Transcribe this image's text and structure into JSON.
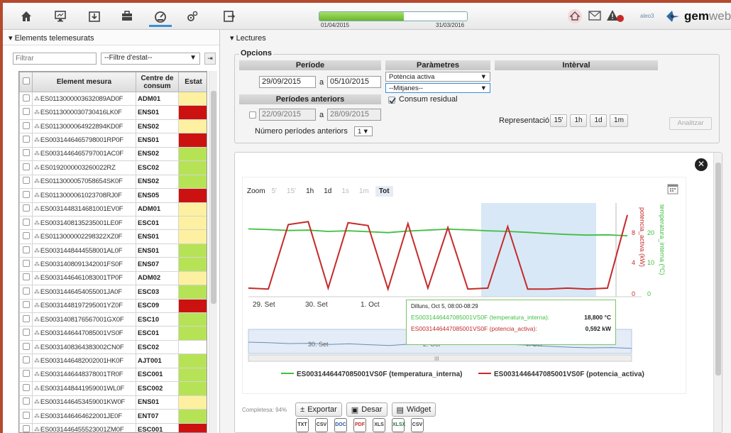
{
  "toolbar": {
    "icons": [
      "home-icon",
      "monitor-icon",
      "download-box-icon",
      "briefcase-icon",
      "gauge-icon",
      "gears-icon",
      "export-icon"
    ],
    "progress": 0.57,
    "progress_start": "01/04/2015",
    "progress_end": "31/03/2016",
    "user": "aleo3",
    "brand_main": "gem",
    "brand_suffix": "web"
  },
  "left": {
    "title": "Elements telemesurats",
    "filter_placeholder": "Filtrar",
    "state_filter": "--Filtre d'estat--",
    "columns": [
      "Element mesura",
      "Centre de consum",
      "Estat"
    ],
    "rows": [
      {
        "name": "ES0113000003632089AD0F",
        "code": "ADM01",
        "state": "#fdf0a0"
      },
      {
        "name": "ES0113000030730416LK0F",
        "code": "ENS01",
        "state": "#cc1111"
      },
      {
        "name": "ES0113000064922894KD0F",
        "code": "ENS02",
        "state": "#fdf0a0"
      },
      {
        "name": "ES0031446465798001RP0F",
        "code": "ENS01",
        "state": "#cc1111"
      },
      {
        "name": "ES0031446465797001AC0F",
        "code": "ENS02",
        "state": "#b6e355"
      },
      {
        "name": "ES0192000003260022RZ",
        "code": "ESC02",
        "state": "#b6e355"
      },
      {
        "name": "ES0113000057058654SK0F",
        "code": "ENS02",
        "state": "#b6e355"
      },
      {
        "name": "ES0113000061023708RJ0F",
        "code": "ENS05",
        "state": "#cc1111"
      },
      {
        "name": "ES0031448314681001EV0F",
        "code": "ADM01",
        "state": "#fdf0a0"
      },
      {
        "name": "ES0031408135235001LE0F",
        "code": "ESC01",
        "state": "#fdf0a0"
      },
      {
        "name": "ES0113000002298322XZ0F",
        "code": "ENS01",
        "state": "#fdf0a0"
      },
      {
        "name": "ES0031448444558001AL0F",
        "code": "ENS01",
        "state": "#b6e355"
      },
      {
        "name": "ES0031408091342001FS0F",
        "code": "ENS07",
        "state": "#b6e355"
      },
      {
        "name": "ES0031446461083001TP0F",
        "code": "ADM02",
        "state": "#fdf0a0"
      },
      {
        "name": "ES0031446454055001JA0F",
        "code": "ESC03",
        "state": "#b6e355"
      },
      {
        "name": "ES0031448197295001YZ0F",
        "code": "ESC09",
        "state": "#cc1111"
      },
      {
        "name": "ES0031408176567001GX0F",
        "code": "ESC10",
        "state": "#b6e355"
      },
      {
        "name": "ES0031446447085001VS0F",
        "code": "ESC01",
        "state": "#b6e355"
      },
      {
        "name": "ES0031408364383002CN0F",
        "code": "ESC02",
        "state": "#ffffff"
      },
      {
        "name": "ES0031446482002001HK0F",
        "code": "AJT001",
        "state": "#b6e355"
      },
      {
        "name": "ES0031446448378001TR0F",
        "code": "ESC001",
        "state": "#b6e355"
      },
      {
        "name": "ES0031448441959001WL0F",
        "code": "ESC002",
        "state": "#b6e355"
      },
      {
        "name": "ES0031446453459001KW0F",
        "code": "ENS01",
        "state": "#fdf0a0"
      },
      {
        "name": "ES0031446464622001JE0F",
        "code": "ENT07",
        "state": "#b6e355"
      },
      {
        "name": "ES0031446455523001ZM0F",
        "code": "ESC001",
        "state": "#cc1111"
      }
    ]
  },
  "right": {
    "title": "Lectures",
    "opcions": "Opcions",
    "periode": "Període",
    "date_from": "29/09/2015",
    "date_to": "05/10/2015",
    "a_label": "a",
    "periodes_anteriors": "Períodes anteriors",
    "prev_from": "22/09/2015",
    "prev_to": "28/09/2015",
    "num_prev_label": "Número períodes anteriors",
    "num_prev_value": "1",
    "parametres": "Paràmetres",
    "param1": "Potència activa",
    "param2": "--Mitjanes--",
    "consum_residual": "Consum residual",
    "interval": "Intèrval",
    "representacio": "Representació:",
    "rep_buttons": [
      "15'",
      "1h",
      "1d",
      "1m"
    ],
    "analitzar": "Analitzar"
  },
  "chart_data": {
    "type": "line",
    "zoom_label": "Zoom",
    "zoom_buttons": [
      "5'",
      "15'",
      "1h",
      "1d",
      "1s",
      "1m",
      "Tot"
    ],
    "xticks": [
      "29. Set",
      "30. Set",
      "1. Oct"
    ],
    "y_left_label": "potencia_activa (kW)",
    "y_left_ticks": [
      "8",
      "4",
      "0"
    ],
    "y_right_label": "temperatura_interna (ºC)",
    "y_right_ticks": [
      "20",
      "10",
      "0"
    ],
    "navigator_labels": [
      "30. Set",
      "2. Oct",
      "4. Oct"
    ],
    "navigator_mid": "III",
    "series": [
      {
        "name": "ES0031446447085001VS0F (temperatura_interna)",
        "color": "#3fbf3f",
        "values": [
          21,
          20.8,
          20.5,
          20.6,
          20.2,
          20.4,
          20.1,
          19.8,
          20.3,
          20.6,
          20.9,
          20.7,
          20.4,
          20.2,
          19.9,
          19.5,
          19.2,
          19,
          19.1,
          18.8
        ]
      },
      {
        "name": "ES0031446447085001VS0F (potencia_activa)",
        "color": "#c62a2a",
        "values": [
          0.6,
          0.5,
          7.2,
          7.5,
          0.6,
          7.4,
          7.1,
          0.5,
          7.3,
          0.6,
          6.9,
          0.5,
          0.6,
          7.0,
          0.5,
          0.5,
          0.6,
          0.5,
          0.6,
          8.2
        ]
      }
    ],
    "tooltip": {
      "title": "Dilluns, Oct 5, 08:00-08:29",
      "row1_label": "ES0031446447085001VS0F (temperatura_interna):",
      "row1_value": "18,800 °C",
      "row2_label": "ES0031446447085001VS0F (potencia_activa):",
      "row2_value": "0,592 kW"
    }
  },
  "footer": {
    "completesa": "Completesa: 94%",
    "exportar": "Exportar",
    "desar": "Desar",
    "widget": "Widget",
    "file_types": [
      "TXT",
      "CSV",
      "DOC",
      "PDF",
      "XLS",
      "XLSX",
      "CSV"
    ]
  }
}
